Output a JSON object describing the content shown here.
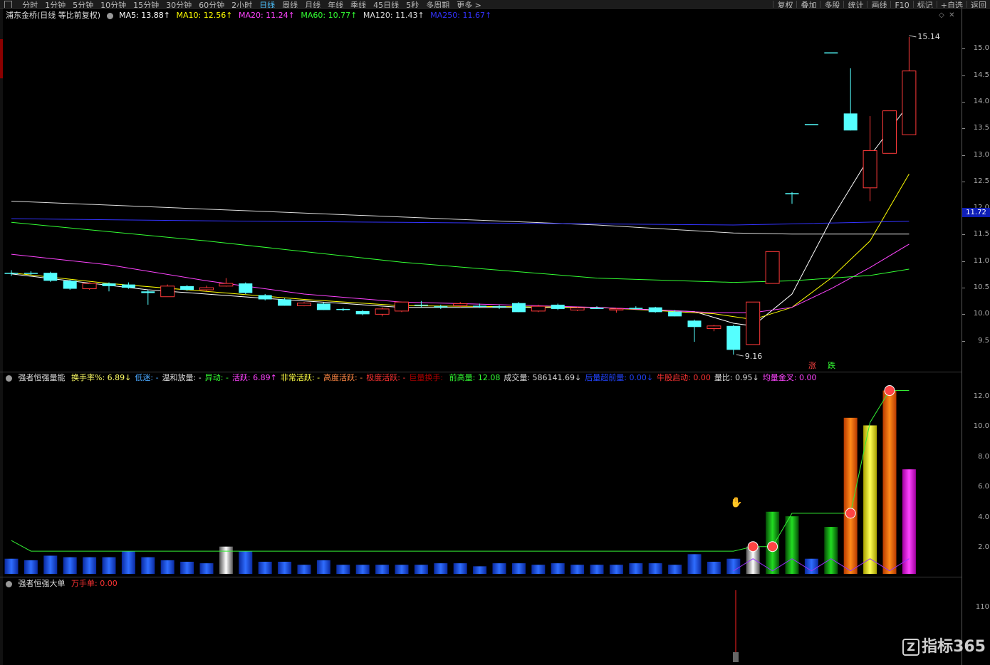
{
  "toolbar": {
    "periods": [
      "分时",
      "1分钟",
      "5分钟",
      "10分钟",
      "15分钟",
      "30分钟",
      "60分钟",
      "2小时",
      "日线",
      "周线",
      "月线",
      "年线",
      "季线",
      "45日线",
      "5秒",
      "多周期",
      "更多 >"
    ],
    "active_period": "日线",
    "right_items": [
      "复权",
      "叠加",
      "多股",
      "统计",
      "画线",
      "F10",
      "标记",
      "+自选",
      "返回"
    ]
  },
  "main_header": {
    "stock_title": "浦东金桥(日线 等比前复权)",
    "ma5": "MA5: 13.88↑",
    "ma10": "MA10: 12.56↑",
    "ma20": "MA20: 11.24↑",
    "ma60": "MA60: 10.77↑",
    "ma120": "MA120: 11.43↑",
    "ma250": "MA250: 11.67↑",
    "colors": {
      "ma5": "#ffffff",
      "ma10": "#ffff00",
      "ma20": "#ff44ff",
      "ma60": "#33ff33",
      "ma120": "#dddddd",
      "ma250": "#3333ff"
    }
  },
  "vol_header": {
    "indicator": "强者恒强量能",
    "fields": [
      {
        "label": "换手率%: ",
        "value": "6.89↓",
        "color": "#ffff66"
      },
      {
        "label": "低迷: ",
        "value": "-",
        "color": "#4aa8ff"
      },
      {
        "label": "温和放量: ",
        "value": "-",
        "color": "#dddddd"
      },
      {
        "label": "异动: ",
        "value": "-",
        "color": "#33ff33"
      },
      {
        "label": "活跃: ",
        "value": "6.89↑",
        "color": "#ff44ff"
      },
      {
        "label": "非常活跃: ",
        "value": "-",
        "color": "#ffff44"
      },
      {
        "label": "高度活跃: ",
        "value": "-",
        "color": "#ff8844"
      },
      {
        "label": "极度活跃: ",
        "value": "-",
        "color": "#ff3333"
      },
      {
        "label": "巨量换手: ",
        "value": "",
        "color": "#aa0000"
      },
      {
        "label": "前高量: ",
        "value": "12.08",
        "color": "#33ff33"
      },
      {
        "label": "成交量: ",
        "value": "586141.69↓",
        "color": "#dddddd"
      },
      {
        "label": "后量超前量: ",
        "value": "0.00↓",
        "color": "#2244ff"
      },
      {
        "label": "牛股启动: ",
        "value": "0.00",
        "color": "#ff3333"
      },
      {
        "label": "量比: ",
        "value": "0.95↓",
        "color": "#dddddd"
      },
      {
        "label": "均量金叉: ",
        "value": "0.00",
        "color": "#ff44ff"
      }
    ]
  },
  "big_header": {
    "indicator": "强者恒强大单",
    "field_label": "万手单: ",
    "field_value": "0.00"
  },
  "price_axis": [
    "15.0",
    "14.5",
    "14.0",
    "13.5",
    "13.0",
    "12.5",
    "12.0",
    "11.5",
    "11.0",
    "10.5",
    "10.0",
    "9.5"
  ],
  "current_price_tag": "11.72",
  "vol_axis": [
    "12.0",
    "10.0",
    "8.0",
    "6.0",
    "4.0",
    "2.0"
  ],
  "big_axis": [
    "110"
  ],
  "annotations": {
    "high": "15.14",
    "low": "9.16",
    "up_label": "涨",
    "down_label": "跌"
  },
  "watermark": "指标365",
  "chart_data": {
    "type": "candlestick",
    "price_range": [
      9.0,
      15.3
    ],
    "candles": [
      {
        "o": 10.7,
        "h": 10.75,
        "l": 10.64,
        "c": 10.7
      },
      {
        "o": 10.7,
        "h": 10.73,
        "l": 10.66,
        "c": 10.68
      },
      {
        "o": 10.7,
        "h": 10.72,
        "l": 10.53,
        "c": 10.55
      },
      {
        "o": 10.55,
        "h": 10.57,
        "l": 10.38,
        "c": 10.4
      },
      {
        "o": 10.4,
        "h": 10.52,
        "l": 10.38,
        "c": 10.5
      },
      {
        "o": 10.5,
        "h": 10.52,
        "l": 10.35,
        "c": 10.45
      },
      {
        "o": 10.48,
        "h": 10.52,
        "l": 10.4,
        "c": 10.42
      },
      {
        "o": 10.35,
        "h": 10.38,
        "l": 10.1,
        "c": 10.32
      },
      {
        "o": 10.25,
        "h": 10.48,
        "l": 10.25,
        "c": 10.45
      },
      {
        "o": 10.45,
        "h": 10.47,
        "l": 10.36,
        "c": 10.38
      },
      {
        "o": 10.38,
        "h": 10.46,
        "l": 10.36,
        "c": 10.42
      },
      {
        "o": 10.45,
        "h": 10.6,
        "l": 10.44,
        "c": 10.5
      },
      {
        "o": 10.5,
        "h": 10.52,
        "l": 10.3,
        "c": 10.32
      },
      {
        "o": 10.28,
        "h": 10.3,
        "l": 10.18,
        "c": 10.2
      },
      {
        "o": 10.2,
        "h": 10.22,
        "l": 10.08,
        "c": 10.08
      },
      {
        "o": 10.08,
        "h": 10.15,
        "l": 10.07,
        "c": 10.13
      },
      {
        "o": 10.12,
        "h": 10.14,
        "l": 10.0,
        "c": 10.0
      },
      {
        "o": 10.02,
        "h": 10.04,
        "l": 9.98,
        "c": 10.0
      },
      {
        "o": 9.98,
        "h": 10.0,
        "l": 9.9,
        "c": 9.92
      },
      {
        "o": 9.92,
        "h": 10.05,
        "l": 9.88,
        "c": 10.02
      },
      {
        "o": 9.98,
        "h": 10.15,
        "l": 9.96,
        "c": 10.15
      },
      {
        "o": 10.1,
        "h": 10.17,
        "l": 10.05,
        "c": 10.08
      },
      {
        "o": 10.07,
        "h": 10.1,
        "l": 10.02,
        "c": 10.07
      },
      {
        "o": 10.08,
        "h": 10.15,
        "l": 10.05,
        "c": 10.12
      },
      {
        "o": 10.08,
        "h": 10.12,
        "l": 10.04,
        "c": 10.07
      },
      {
        "o": 10.07,
        "h": 10.1,
        "l": 10.02,
        "c": 10.05
      },
      {
        "o": 10.13,
        "h": 10.15,
        "l": 9.96,
        "c": 9.96
      },
      {
        "o": 9.98,
        "h": 10.1,
        "l": 9.96,
        "c": 10.07
      },
      {
        "o": 10.1,
        "h": 10.12,
        "l": 10.0,
        "c": 10.02
      },
      {
        "o": 10.0,
        "h": 10.06,
        "l": 9.98,
        "c": 10.04
      },
      {
        "o": 10.04,
        "h": 10.07,
        "l": 10.02,
        "c": 10.04
      },
      {
        "o": 10.0,
        "h": 10.04,
        "l": 9.95,
        "c": 10.02
      },
      {
        "o": 10.04,
        "h": 10.07,
        "l": 10.02,
        "c": 10.04
      },
      {
        "o": 10.05,
        "h": 10.06,
        "l": 9.95,
        "c": 9.96
      },
      {
        "o": 9.97,
        "h": 10.0,
        "l": 9.88,
        "c": 9.88
      },
      {
        "o": 9.8,
        "h": 9.82,
        "l": 9.4,
        "c": 9.68
      },
      {
        "o": 9.65,
        "h": 9.72,
        "l": 9.6,
        "c": 9.7
      },
      {
        "o": 9.7,
        "h": 9.72,
        "l": 9.16,
        "c": 9.25
      },
      {
        "o": 9.35,
        "h": 10.15,
        "l": 9.35,
        "c": 10.15
      },
      {
        "o": 10.5,
        "h": 11.1,
        "l": 10.5,
        "c": 11.1
      },
      {
        "o": 12.2,
        "h": 12.22,
        "l": 12.0,
        "c": 12.2
      },
      {
        "o": 13.5,
        "h": 13.5,
        "l": 13.5,
        "c": 13.5
      },
      {
        "o": 14.85,
        "h": 14.85,
        "l": 14.85,
        "c": 14.85
      },
      {
        "o": 13.7,
        "h": 14.55,
        "l": 13.38,
        "c": 13.38
      },
      {
        "o": 12.3,
        "h": 13.65,
        "l": 12.05,
        "c": 13.0
      },
      {
        "o": 12.95,
        "h": 13.65,
        "l": 12.95,
        "c": 13.75
      },
      {
        "o": 13.3,
        "h": 15.14,
        "l": 13.3,
        "c": 14.5
      }
    ],
    "ma_series": [
      {
        "name": "MA5",
        "color": "#ffffff",
        "points": [
          [
            0,
            10.68
          ],
          [
            3,
            10.55
          ],
          [
            7,
            10.38
          ],
          [
            13,
            10.22
          ],
          [
            20,
            10.05
          ],
          [
            30,
            10.05
          ],
          [
            35,
            9.97
          ],
          [
            37,
            9.75
          ],
          [
            38,
            9.7
          ],
          [
            40,
            10.3
          ],
          [
            42,
            11.7
          ],
          [
            43,
            12.3
          ],
          [
            44,
            12.9
          ],
          [
            46,
            13.88
          ]
        ]
      },
      {
        "name": "MA10",
        "color": "#ffff00",
        "points": [
          [
            0,
            10.7
          ],
          [
            5,
            10.5
          ],
          [
            10,
            10.35
          ],
          [
            15,
            10.2
          ],
          [
            20,
            10.08
          ],
          [
            30,
            10.05
          ],
          [
            36,
            9.93
          ],
          [
            38,
            9.82
          ],
          [
            40,
            10.05
          ],
          [
            42,
            10.6
          ],
          [
            44,
            11.3
          ],
          [
            46,
            12.56
          ]
        ]
      },
      {
        "name": "MA20",
        "color": "#ff44ff",
        "points": [
          [
            0,
            11.05
          ],
          [
            5,
            10.85
          ],
          [
            10,
            10.55
          ],
          [
            15,
            10.3
          ],
          [
            20,
            10.15
          ],
          [
            30,
            10.05
          ],
          [
            36,
            9.95
          ],
          [
            38,
            9.95
          ],
          [
            40,
            10.05
          ],
          [
            42,
            10.4
          ],
          [
            44,
            10.8
          ],
          [
            46,
            11.24
          ]
        ]
      },
      {
        "name": "MA60",
        "color": "#33ff33",
        "points": [
          [
            0,
            11.65
          ],
          [
            10,
            11.3
          ],
          [
            20,
            10.9
          ],
          [
            30,
            10.6
          ],
          [
            37,
            10.52
          ],
          [
            40,
            10.55
          ],
          [
            44,
            10.65
          ],
          [
            46,
            10.77
          ]
        ]
      },
      {
        "name": "MA120",
        "color": "#dddddd",
        "points": [
          [
            0,
            12.05
          ],
          [
            10,
            11.9
          ],
          [
            20,
            11.75
          ],
          [
            30,
            11.6
          ],
          [
            37,
            11.45
          ],
          [
            40,
            11.43
          ],
          [
            46,
            11.43
          ]
        ]
      },
      {
        "name": "MA250",
        "color": "#3333ff",
        "points": [
          [
            0,
            11.72
          ],
          [
            10,
            11.68
          ],
          [
            20,
            11.65
          ],
          [
            30,
            11.62
          ],
          [
            37,
            11.6
          ],
          [
            40,
            11.62
          ],
          [
            46,
            11.67
          ]
        ]
      }
    ],
    "volume": [
      1.0,
      0.9,
      1.2,
      1.1,
      1.1,
      1.1,
      1.5,
      1.1,
      0.9,
      0.8,
      0.7,
      1.8,
      1.5,
      0.8,
      0.8,
      0.6,
      0.9,
      0.6,
      0.6,
      0.6,
      0.6,
      0.6,
      0.7,
      0.7,
      0.5,
      0.7,
      0.7,
      0.6,
      0.7,
      0.6,
      0.6,
      0.6,
      0.7,
      0.7,
      0.6,
      1.3,
      0.8,
      1.0,
      1.8,
      4.1,
      3.8,
      1.0,
      3.1,
      10.3,
      9.8,
      12.1,
      6.9
    ],
    "volume_colors": [
      "blue",
      "blue",
      "blue",
      "blue",
      "blue",
      "blue",
      "blue",
      "blue",
      "blue",
      "blue",
      "blue",
      "white",
      "blue",
      "blue",
      "blue",
      "blue",
      "blue",
      "blue",
      "blue",
      "blue",
      "blue",
      "blue",
      "blue",
      "blue",
      "blue",
      "blue",
      "blue",
      "blue",
      "blue",
      "blue",
      "blue",
      "blue",
      "blue",
      "blue",
      "blue",
      "blue",
      "blue",
      "blue",
      "white",
      "green",
      "green",
      "blue",
      "green",
      "orange",
      "yellow",
      "orange",
      "magenta"
    ],
    "prev_high_volume_line": [
      [
        0,
        2.2
      ],
      [
        1,
        1.5
      ],
      [
        37,
        1.5
      ],
      [
        38,
        1.8
      ],
      [
        39,
        1.8
      ],
      [
        40,
        4.0
      ],
      [
        43,
        4.0
      ],
      [
        44,
        10.0
      ],
      [
        45,
        12.1
      ],
      [
        46,
        12.1
      ]
    ],
    "vol_range": [
      0,
      12.5
    ]
  }
}
